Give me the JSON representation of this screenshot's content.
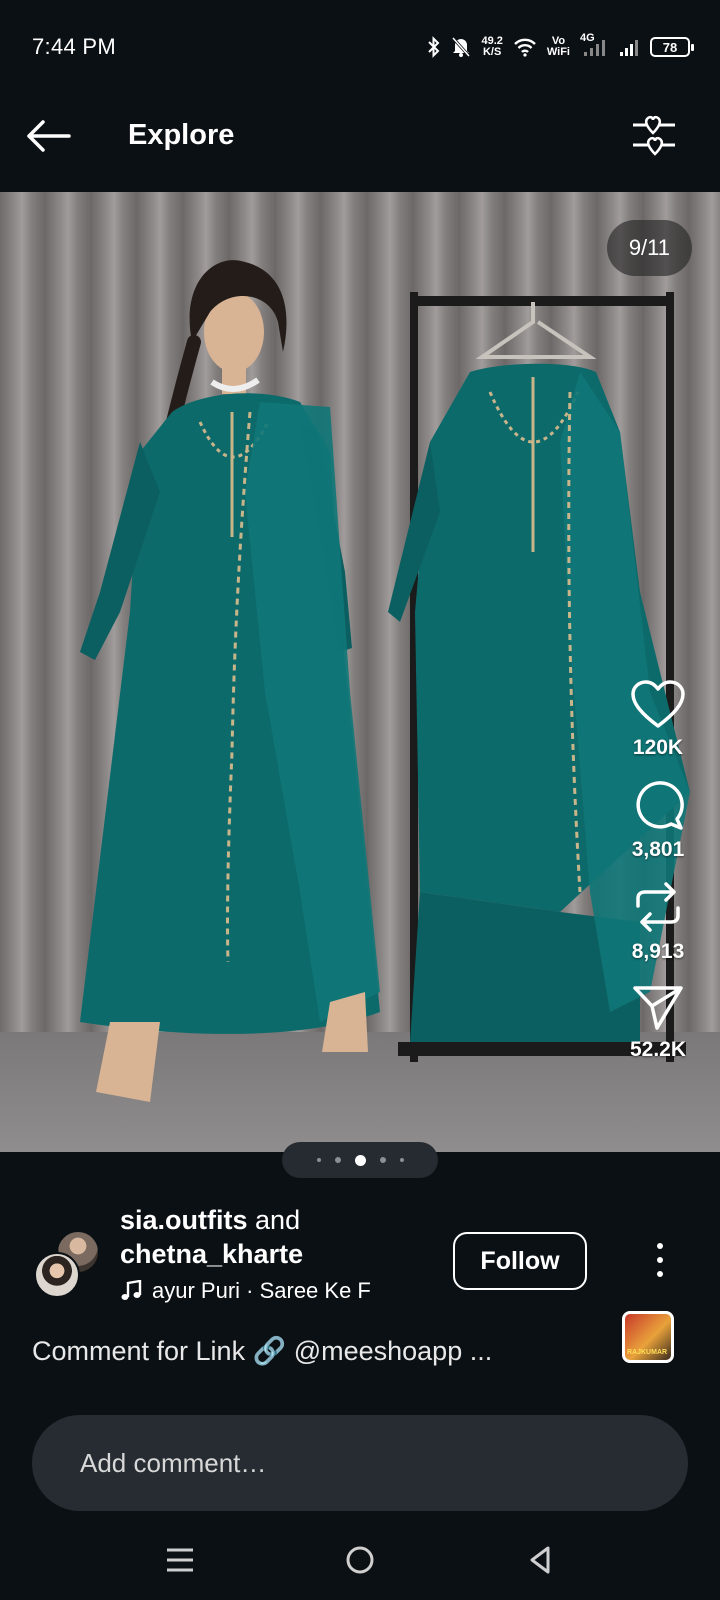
{
  "status": {
    "time": "7:44 PM",
    "net_speed_value": "49.2",
    "net_speed_unit": "K/S",
    "volte_top": "Vo",
    "volte_bottom": "WiFi",
    "network": "4G",
    "battery": "78"
  },
  "header": {
    "title": "Explore"
  },
  "media": {
    "counter": "9/11",
    "dots_total": 5,
    "dots_active": 2
  },
  "actions": {
    "likes": "120K",
    "comments": "3,801",
    "reposts": "8,913",
    "shares": "52.2K"
  },
  "post": {
    "author_primary": "sia.outfits",
    "author_joiner": "and",
    "author_secondary": "chetna_kharte",
    "audio": "ayur Puri · Saree Ke F",
    "follow_label": "Follow",
    "audio_thumb_text": "RAJKUMAR",
    "caption": "Comment for Link 🔗 @meeshoapp ..."
  },
  "comment": {
    "placeholder": "Add comment…"
  },
  "colors": {
    "background": "#0b1014",
    "pill": "#262c31",
    "dress": "#0d6a6b"
  }
}
